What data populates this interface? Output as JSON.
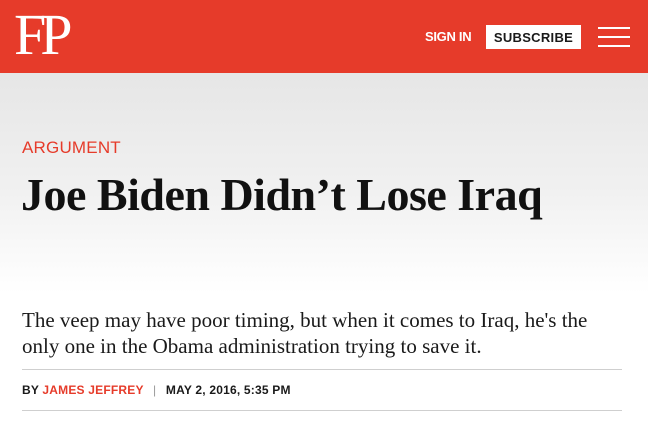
{
  "header": {
    "logo": "FP",
    "signin_label": "SIGN IN",
    "subscribe_label": "SUBSCRIBE",
    "menu_icon": "hamburger-menu-icon",
    "brand_color": "#e63b2a"
  },
  "article": {
    "kicker": "ARGUMENT",
    "headline": "Joe Biden Didn’t Lose Iraq",
    "dek": "The veep may have poor timing, but when it comes to Iraq, he's the only one in the Obama administration trying to save it.",
    "byline_prefix": "BY",
    "author": "JAMES JEFFREY",
    "separator": "|",
    "date": "MAY 2, 2016, 5:35 PM"
  }
}
